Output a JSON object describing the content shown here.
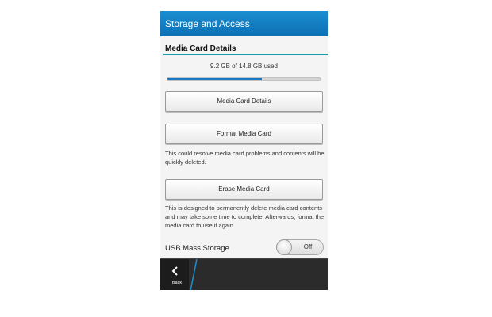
{
  "header": {
    "title": "Storage and Access"
  },
  "section": {
    "title": "Media Card Details"
  },
  "usage": {
    "text": "9.2 GB of 14.8 GB used",
    "fraction": 0.62
  },
  "buttons": {
    "details": "Media Card Details",
    "format": "Format Media Card",
    "erase": "Erase Media Card"
  },
  "notes": {
    "format": "This could resolve media card problems and contents will be quickly deleted.",
    "erase": "This is designed to permanently delete media card contents and may take some time to complete. Afterwards, format the media card to use it again."
  },
  "usb": {
    "label": "USB Mass Storage",
    "state": "Off"
  },
  "actionbar": {
    "back_label": "Back",
    "back_icon": "chevron-left-icon"
  },
  "colors": {
    "titlebar": "#1b8fd0",
    "accent_rule": "#1aa0a8",
    "progress": "#1a78c2",
    "divider": "#1a8fd0"
  }
}
